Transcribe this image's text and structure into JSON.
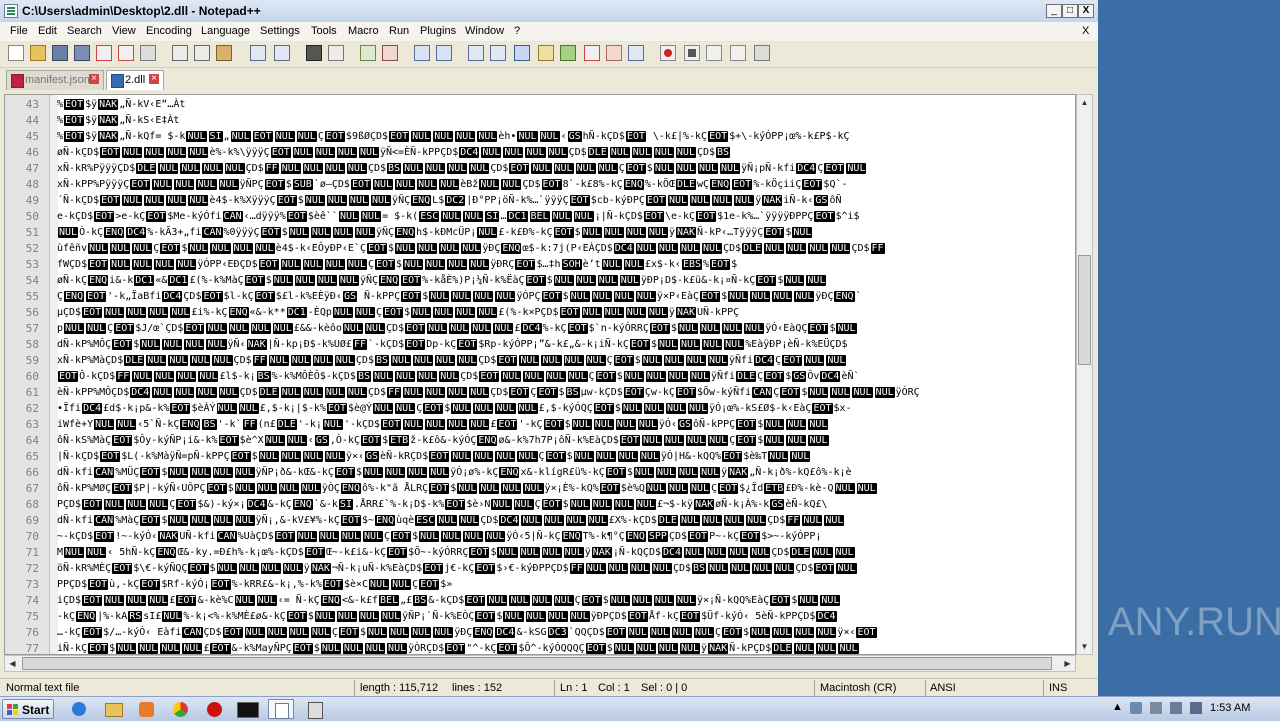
{
  "window": {
    "title": "C:\\Users\\admin\\Desktop\\2.dll - Notepad++",
    "controls": {
      "minimize": "_",
      "maximize": "□",
      "close": "X"
    }
  },
  "menu": {
    "items": [
      "File",
      "Edit",
      "Search",
      "View",
      "Encoding",
      "Language",
      "Settings",
      "Tools",
      "Macro",
      "Run",
      "Plugins",
      "Window",
      "?"
    ],
    "close_glyph": "X"
  },
  "tabs": [
    {
      "label": "manifest.json",
      "active": false
    },
    {
      "label": "2.dll",
      "active": true
    }
  ],
  "editor": {
    "lines": [
      {
        "n": "43",
        "t": "%<b>EOT</b>$ÿ<b>NAK</b>„Ñ-kV‹E“…Àt"
      },
      {
        "n": "44",
        "t": "%<b>EOT</b>$ÿ<b>NAK</b>„Ñ-kS‹E‡Àt"
      },
      {
        "n": "45",
        "t": "%<b>EOT</b>$ÿ<b>NAK</b>„Ñ-kQf= $-k<b>NUL</b><b>SI</b>„<b>NUL</b><b>EOT</b><b>NUL</b><b>NUL</b>Ç<b>EOT</b>$9ßØÇD$<b>EOT</b><b>NUL</b><b>NUL</b><b>NUL</b><b>NUL</b>èh•<b>NUL</b><b>NUL</b>‹<b>GS</b>hÑ-kÇD$<b>EOT</b> \\-k£|%-kÇ<b>EOT</b>$+\\-kýÓPP¡œ%-k£P$-kÇ"
      },
      {
        "n": "46",
        "t": "øÑ-kÇD$<b>EOT</b><b>NUL</b><b>NUL</b><b>NUL</b><b>NUL</b>è%-k%\\ÿÿÿÇ<b>EOT</b><b>NUL</b><b>NUL</b><b>NUL</b><b>NUL</b>ÿÑ<=ÈÑ-kPPÇD$<b>DC4</b><b>NUL</b><b>NUL</b><b>NUL</b><b>NUL</b>ÇD$<b>DLE</b><b>NUL</b><b>NUL</b><b>NUL</b><b>NUL</b>ÇD$<b>BS</b>"
      },
      {
        "n": "47",
        "t": "xÑ-kR%PÿÿÿÇD$<b>DLE</b><b>NUL</b><b>NUL</b><b>NUL</b><b>NUL</b>ÇD$<b>FF</b><b>NUL</b><b>NUL</b><b>NUL</b><b>NUL</b>ÇD$<b>BS</b><b>NUL</b><b>NUL</b><b>NUL</b><b>NUL</b>ÇD$<b>EOT</b><b>NUL</b><b>NUL</b><b>NUL</b><b>NUL</b>Ç<b>EOT</b>$<b>NUL</b><b>NUL</b><b>NUL</b><b>NUL</b>ÿÑ¡pÑ-kfi<b>DC4</b>Ç<b>EOT</b><b>NUL</b>"
      },
      {
        "n": "48",
        "t": "xÑ-kPP%PÿÿÿÇ<b>EOT</b><b>NUL</b><b>NUL</b><b>NUL</b><b>NUL</b>ÿÑPÇ<b>EOT</b>$<b>SUB</b>`ø—ÇD$<b>EOT</b><b>NUL</b><b>NUL</b><b>NUL</b><b>NUL</b>èBž<b>NUL</b><b>NUL</b>ÇD$<b>EOT</b>8`-k£8%-kÇ<b>ENQ</b>%-kÖŒ<b>DLE</b>wÇ<b>ENQ</b><b>EOT</b>%-kÖçiiÇ<b>EOT</b>$Q`-"
      },
      {
        "n": "49",
        "t": "´Ñ-kÇD$<b>EOT</b><b>NUL</b><b>NUL</b><b>NUL</b><b>NUL</b>è4$-k%XÿÿÿÇ<b>EOT</b>$<b>NUL</b><b>NUL</b><b>NUL</b><b>NUL</b>ÿÑÇ<b>ENQ</b>L$<b>DC2</b>|Ð°PP¡öÑ-k%…`ÿÿÿÇ<b>EOT</b>$cb-kýÐPÇ<b>EOT</b><b>NUL</b><b>NUL</b><b>NUL</b><b>NUL</b>ÿ<b>NAK</b>iÑ-k‹<b>GS</b>ôÑ"
      },
      {
        "n": "50",
        "t": "e-kÇD$<b>EOT</b>>e-kÇ<b>EOT</b>$Me-kýÓfi<b>CAN</b>‹…dÿÿÿ%<b>EOT</b>$èê``<b>NUL</b><b>NUL</b>= $-k(<b>ESC</b><b>NUL</b><b>NUL</b><b>SI</b>…<b>DC1</b><b>BEL</b><b>NUL</b><b>NUL</b>¡|Ñ-kÇD$<b>EOT</b>\\e-kÇ<b>EOT</b>$1e-k%…`ÿÿÿÿÐPPÇ<b>EOT</b>$^i$"
      },
      {
        "n": "51",
        "t": "<b>NUL</b>Ò-kÇ<b>ENQ</b><b>DC4</b>%-kÃ3+„fi<b>CAN</b>%0ÿÿÿÇ<b>EOT</b>$<b>NUL</b><b>NUL</b><b>NUL</b><b>NUL</b>ÿÑÇ<b>ENQ</b>h$-kÐMcÜP¡<b>NUL</b>£-k£Ð%-kÇ<b>EOT</b>$<b>NUL</b><b>NUL</b><b>NUL</b><b>NUL</b>ÿ<b>NAK</b>Ñ-kP‹…TÿÿÿÇ<b>EOT</b>$<b>NUL</b>"
      },
      {
        "n": "52",
        "t": "ùfêñv<b>NUL</b><b>NUL</b><b>NUL</b>Ç<b>EOT</b>$<b>NUL</b><b>NUL</b><b>NUL</b><b>NUL</b>è4$-k‹EÔyÐP‹E`Ç<b>EOT</b>$<b>NUL</b><b>NUL</b><b>NUL</b><b>NUL</b>ÿÐÇ<b>ENQ</b>œ$-k:7j(P‹EÀÇD$<b>DC4</b><b>NUL</b><b>NUL</b><b>NUL</b><b>NUL</b>ÇD$<b>DLE</b><b>NUL</b><b>NUL</b><b>NUL</b><b>NUL</b>ÇD$<b>FF</b>"
      },
      {
        "n": "53",
        "t": "fWÇD$<b>EOT</b><b>NUL</b><b>NUL</b><b>NUL</b><b>NUL</b>ÿÓPP‹EÐÇD$<b>EOT</b><b>NUL</b><b>NUL</b><b>NUL</b><b>NUL</b>Ç<b>EOT</b>$<b>NUL</b><b>NUL</b><b>NUL</b><b>NUL</b>ÿÐRÇ<b>EOT</b>$…‡h<b>SOH</b>è’t<b>NUL</b><b>NUL</b>£x$-k‹<b>EBS</b>%<b>EOT</b>$"
      },
      {
        "n": "54",
        "t": "øÑ-kÇ<b>ENQ</b>i&-k<b>DC1</b>«&<b>DC1</b>£(%-k%MàÇ<b>EOT</b>$<b>NUL</b><b>NUL</b><b>NUL</b><b>NUL</b>ÿÑÇ<b>ENQ</b><b>EOT</b>%-kåÈ%)P¡¼Ñ-k%ËàÇ<b>EOT</b>$<b>NUL</b><b>NUL</b><b>NUL</b><b>NUL</b>ÿÐP¡D$-k£ü&-k¡¤Ñ-kÇ<b>EOT</b>$<b>NUL</b><b>NUL</b>"
      },
      {
        "n": "55",
        "t": "Ç<b>ENQ</b><b>EOT</b>'-k„ÏaBfi<b>DC4</b>ÇD$<b>EOT</b>$l-kÇ<b>EOT</b>$£l-k%EÈÿÐ‹<b>GS</b> Ñ-kPPÇ<b>EOT</b>$<b>NUL</b><b>NUL</b><b>NUL</b><b>NUL</b>ÿÓPÇ<b>EOT</b>$<b>NUL</b><b>NUL</b><b>NUL</b><b>NUL</b>ÿ×P‹EàÇ<b>EOT</b>$<b>NUL</b><b>NUL</b><b>NUL</b><b>NUL</b>ÿÐÇ<b>ENQ</b>`"
      },
      {
        "n": "56",
        "t": "µÇD$<b>EOT</b><b>NUL</b><b>NUL</b><b>NUL</b><b>NUL</b>£i%-kÇ<b>ENQ</b>«&-k**<b>DC1</b>-ÈQp<b>NUL</b><b>NUL</b>Ç<b>EOT</b>$<b>NUL</b><b>NUL</b><b>NUL</b><b>NUL</b>£(%-k×PÇD$<b>EOT</b><b>NUL</b><b>NUL</b><b>NUL</b><b>NUL</b>ÿ<b>NAK</b>UÑ-kPPÇ"
      },
      {
        "n": "57",
        "t": "p<b>NUL</b><b>NUL</b>Ç<b>EOT</b>$J/œ`ÇD$<b>EOT</b><b>NUL</b><b>NUL</b><b>NUL</b><b>NUL</b>£&&-kèôo<b>NUL</b><b>NUL</b>ÇD$<b>EOT</b><b>NUL</b><b>NUL</b><b>NUL</b><b>NUL</b>£<b>DC4</b>%-kÇ<b>EOT</b>$`n-kýÓRRÇ<b>EOT</b>$<b>NUL</b><b>NUL</b><b>NUL</b><b>NUL</b>ÿÓ‹EàQÇ<b>EOT</b>$<b>NUL</b>"
      },
      {
        "n": "58",
        "t": "dÑ-kP%MÔÇ<b>EOT</b>$<b>NUL</b><b>NUL</b><b>NUL</b><b>NUL</b>ÿÑ‹<b>NAK</b>|Ñ-kp¡Ð$-k%UØ£<b>FF</b>`-kÇD$<b>EOT</b>Dp-kÇ<b>EOT</b>$Rp-kýÓPP¡”&-k£„&-k¡iÑ-kÇ<b>EOT</b>$<b>NUL</b><b>NUL</b><b>NUL</b><b>NUL</b>%EàÿÐP¡èÑ-k%EÜÇD$"
      },
      {
        "n": "59",
        "t": "xÑ-kP%MàÇD$<b>DLE</b><b>NUL</b><b>NUL</b><b>NUL</b><b>NUL</b>ÇD$<b>FF</b><b>NUL</b><b>NUL</b><b>NUL</b><b>NUL</b>ÇD$<b>BS</b><b>NUL</b><b>NUL</b><b>NUL</b><b>NUL</b>ÇD$<b>EOT</b><b>NUL</b><b>NUL</b><b>NUL</b><b>NUL</b>Ç<b>EOT</b>$<b>NUL</b><b>NUL</b><b>NUL</b><b>NUL</b>ÿÑfi<b>DC4</b>Ç<b>EOT</b><b>NUL</b><b>NUL</b>"
      },
      {
        "n": "60",
        "t": "<b>EOT</b>Ô-kÇD$<b>FF</b><b>NUL</b><b>NUL</b><b>NUL</b><b>NUL</b>£l$-k¡<b>BS</b>%-k%MÔÈÔ$-kÇD$<b>BS</b><b>NUL</b><b>NUL</b><b>NUL</b><b>NUL</b>ÇD$<b>EOT</b><b>NUL</b><b>NUL</b><b>NUL</b><b>NUL</b>Ç<b>EOT</b>$<b>NUL</b><b>NUL</b><b>NUL</b><b>NUL</b>ÿÑfi<b>DLE</b>Ç<b>EOT</b>$<b>GS</b>Ôv<b>DC4</b>èÑ`"
      },
      {
        "n": "61",
        "t": "èÑ-kPP%MÔÇD$<b>DC4</b><b>NUL</b><b>NUL</b><b>NUL</b><b>NUL</b>ÇD$<b>DLE</b><b>NUL</b><b>NUL</b><b>NUL</b><b>NUL</b>ÇD$<b>FF</b><b>NUL</b><b>NUL</b><b>NUL</b><b>NUL</b>ÇD$<b>EOT</b>Ç<b>EOT</b>$<b>BS</b>µw-kÇD$<b>EOT</b>Çw-kÇ<b>EOT</b>$Õw-kýÑfi<b>CAN</b>Ç<b>EOT</b>$<b>NUL</b><b>NUL</b><b>NUL</b><b>NUL</b>ÿÓRÇ"
      },
      {
        "n": "62",
        "t": "•Ïfi<b>DC4</b>£d$-k¡p&-k%<b>EOT</b>$èÀÝ<b>NUL</b><b>NUL</b>£,$-k¡|$-k%<b>EOT</b>$è@Ý<b>NUL</b><b>NUL</b>Ç<b>EOT</b>$<b>NUL</b><b>NUL</b><b>NUL</b><b>NUL</b>£,$-kýÓQÇ<b>EOT</b>$<b>NUL</b><b>NUL</b><b>NUL</b><b>NUL</b>ÿÓ¡œ%-kS£Ø$-k‹EàÇ<b>EOT</b>$x-"
      },
      {
        "n": "63",
        "t": "iWfè+Y<b>NUL</b><b>NUL</b>‹5`Ñ-kÇ<b>ENQ</b><b>BS</b>'-k`<b>FF</b>(n£<b>DLE</b>'-k¡<b>NUL</b>'-kÇD$<b>EOT</b><b>NUL</b><b>NUL</b><b>NUL</b><b>NUL</b>£<b>EOT</b>'-kÇ<b>EOT</b>$<b>NUL</b><b>NUL</b><b>NUL</b><b>NUL</b>ÿÓ‹<b>GS</b>ôÑ-kPPÇ<b>EOT</b>$<b>NUL</b><b>NUL</b><b>NUL</b>"
      },
      {
        "n": "64",
        "t": "ôÑ-kS%MàÇ<b>EOT</b>$Ôy-kýÑP¡i&-k%<b>EOT</b>$è^X<b>NUL</b><b>NUL</b>‹<b>GS</b>,Ò-kÇ<b>EOT</b>$<b>ETB</b>ž-k£ô&-kýÓÇ<b>ENQ</b>ø&-k%7h7P¡ôÑ-k%EàÇD$<b>EOT</b><b>NUL</b><b>NUL</b><b>NUL</b><b>NUL</b>Ç<b>EOT</b>$<b>NUL</b><b>NUL</b><b>NUL</b>"
      },
      {
        "n": "65",
        "t": "|Ñ-kÇD$<b>EOT</b>$L(-k%MàÿÑ=pÑ-kPPÇ<b>EOT</b>$<b>NUL</b><b>NUL</b><b>NUL</b><b>NUL</b>ÿ×‹<b>GS</b>èÑ-kRÇD$<b>EOT</b><b>NUL</b><b>NUL</b><b>NUL</b><b>NUL</b>Ç<b>EOT</b>$<b>NUL</b><b>NUL</b><b>NUL</b><b>NUL</b>ÿÓ|H&-kQQ%<b>EOT</b>$è‰T<b>NUL</b><b>NUL</b>"
      },
      {
        "n": "66",
        "t": "dÑ-kfi<b>CAN</b>%MÜÇ<b>EOT</b>$<b>NUL</b><b>NUL</b><b>NUL</b><b>NUL</b>ÿÑP¡ð&-kŒ&-kÇ<b>EOT</b>$<b>NUL</b><b>NUL</b><b>NUL</b><b>NUL</b>ÿÓ¡ø%-kÇ<b>ENQ</b>x&-klígR£ü%-kÇ<b>EOT</b>$<b>NUL</b><b>NUL</b><b>NUL</b><b>NUL</b>ÿ<b>NAK</b>„Ñ-k¡ð%-kQ£ô%-k¡è"
      },
      {
        "n": "67",
        "t": "ôÑ-kP%MØÇ<b>EOT</b>$P|-kýÑ‹UÔPÇ<b>EOT</b>$<b>NUL</b><b>NUL</b><b>NUL</b><b>NUL</b>ÿÒÇ<b>ENQ</b>ô%-k\"ã ÅLRÇ<b>EOT</b>$<b>NUL</b><b>NUL</b><b>NUL</b><b>NUL</b>ÿ×¡È%-kQ%<b>EOT</b>$è%Q<b>NUL</b><b>NUL</b><b>NUL</b>Ç<b>EOT</b>$¿Ïd<b>ETB</b>£Ð%-kè-Q<b>NUL</b><b>NUL</b>"
      },
      {
        "n": "68",
        "t": "PÇD$<b>EOT</b><b>NUL</b><b>NUL</b><b>NUL</b>Ç<b>EOT</b>$&)-ký×¡<b>DC4</b>&-kÇ<b>ENQ</b>`&-k<b>SI</b>.ÅRR£`%-k¡D$-k%<b>EOT</b>$è›N<b>NUL</b><b>NUL</b>Ç<b>EOT</b>$<b>NUL</b><b>NUL</b><b>NUL</b><b>NUL</b>£¬$-kÿ<b>NAK</b>øÑ-k¡À%-k<b>GS</b>èÑ-kQ£\\"
      },
      {
        "n": "69",
        "t": "dÑ-kfi<b>CAN</b>%MàÇ<b>EOT</b>$<b>NUL</b><b>NUL</b><b>NUL</b><b>NUL</b>ÿÑ¡,&-kV£¥%-kÇ<b>EOT</b>$~<b>ENQ</b>ùqè<b>ESC</b><b>NUL</b><b>NUL</b>ÇD$<b>DC4</b><b>NUL</b><b>NUL</b><b>NUL</b><b>NUL</b>£X%-kÇD$<b>DLE</b><b>NUL</b><b>NUL</b><b>NUL</b><b>NUL</b>ÇD$<b>FF</b><b>NUL</b><b>NUL</b>"
      },
      {
        "n": "70",
        "t": "~-kÇD$<b>EOT</b>!~-kýÓ‹<b>NAK</b>UÑ-kfi<b>CAN</b>%UàÇD$<b>EOT</b><b>NUL</b><b>NUL</b><b>NUL</b><b>NUL</b>Ç<b>EOT</b>$<b>NUL</b><b>NUL</b><b>NUL</b><b>NUL</b>ÿÓ‹5|Ñ-kÇ<b>ENQ</b>T%-k¶°Ç<b>ENQ</b><b>SPP</b>ÇD$<b>EOT</b>P~-kÇ<b>EOT</b>$>~-kýÓPP¡"
      },
      {
        "n": "71",
        "t": "M<b>NUL</b><b>NUL</b>‹ 5hÑ-kÇ<b>ENQ</b>Œ&-ky.=Ð£h%-k¡œ%-kÇD$<b>EOT</b>Œ~-k£i&-kÇ<b>EOT</b>$Ö~-kýÓRRÇ<b>EOT</b>$<b>NUL</b><b>NUL</b><b>NUL</b><b>NUL</b>ÿ<b>NAK</b>¡Ñ-kQÇD$<b>DC4</b><b>NUL</b><b>NUL</b><b>NUL</b><b>NUL</b>ÇD$<b>DLE</b><b>NUL</b><b>NUL</b>"
      },
      {
        "n": "72",
        "t": "öÑ-kR%MÈÇ<b>EOT</b>$\\€-kýÑQÇ<b>EOT</b>$<b>NUL</b><b>NUL</b><b>NUL</b><b>NUL</b>ÿ<b>NAK</b>¬Ñ-k¡uÑ-k%EàÇD$<b>EOT</b>j€-kÇ<b>EOT</b>$›€-kýÐPPÇD$<b>FF</b><b>NUL</b><b>NUL</b><b>NUL</b><b>NUL</b>ÇD$<b>BS</b><b>NUL</b><b>NUL</b><b>NUL</b><b>NUL</b>ÇD$<b>EOT</b><b>NUL</b>"
      },
      {
        "n": "73",
        "t": "PPÇD$<b>EOT</b>ù,-kÇ<b>EOT</b>$Rf-kýÓ¡<b>EOT</b>%-kRR£&-k¡,%-k%<b>EOT</b>$è×C<b>NUL</b><b>NUL</b>Ç<b>EOT</b>$»"
      },
      {
        "n": "74",
        "t": "iÇD$<b>EOT</b><b>NUL</b><b>NUL</b><b>NUL</b>£<b>EOT</b>&-kè%C<b>NUL</b><b>NUL</b>‹= Ñ-kÇ<b>ENQ</b><&-k£f<b>BEL</b>„£<b>BS</b>&-kÇD$<b>EOT</b><b>NUL</b><b>NUL</b><b>NUL</b><b>NUL</b>Ç<b>EOT</b>$<b>NUL</b><b>NUL</b><b>NUL</b><b>NUL</b>ÿ×¡Ñ-kQQ%EàÇ<b>EOT</b>$<b>NUL</b><b>NUL</b>"
      },
      {
        "n": "75",
        "t": "-kÇ<b>ENQ</b>|%-kA<b>RS</b>sI£<b>NUL</b>%-k¡<%-k%MÈ£ø&-kÇ<b>EOT</b>$<b>NUL</b><b>NUL</b><b>NUL</b><b>NUL</b>ÿÑP¡`Ñ-k%EÒÇ<b>EOT</b>$<b>NUL</b><b>NUL</b><b>NUL</b><b>NUL</b>ÿÐPÇD$<b>EOT</b>Åf-kÇ<b>EOT</b>$Üf-kýÓ‹ 5èÑ-kPPÇD$<b>DC4</b>"
      },
      {
        "n": "76",
        "t": "…-kÇ<b>EOT</b>$/…-kýÓ‹ Eàfi<b>CAN</b>ÇD$<b>EOT</b><b>NUL</b><b>NUL</b><b>NUL</b><b>NUL</b>Ç<b>EOT</b>$<b>NUL</b><b>NUL</b><b>NUL</b><b>NUL</b>ÿÐÇ<b>ENQ</b><b>DC4</b>&-kSG<b>DC3</b>`QQÇD$<b>EOT</b><b>NUL</b><b>NUL</b><b>NUL</b><b>NUL</b>Ç<b>EOT</b>$<b>NUL</b><b>NUL</b><b>NUL</b><b>NUL</b>ÿ×‹<b>EOT</b>"
      },
      {
        "n": "77",
        "t": "iÑ-kÇ<b>EOT</b>$<b>NUL</b><b>NUL</b><b>NUL</b><b>NUL</b>£<b>EOT</b>&-k%MayÑPÇ<b>EOT</b>$<b>NUL</b><b>NUL</b><b>NUL</b><b>NUL</b>ÿÒRÇD$<b>EOT</b>\"^-kÇ<b>EOT</b>$Ô^-kýÓQQQÇ<b>EOT</b>$<b>NUL</b><b>NUL</b><b>NUL</b><b>NUL</b>ÿ<b>NAK</b>Ñ-kPÇD$<b>DLE</b><b>NUL</b><b>NUL</b><b>NUL</b>"
      }
    ]
  },
  "status": {
    "file_type": "Normal text file",
    "length": "length : 115,712",
    "lines": "lines : 152",
    "ln": "Ln : 1",
    "col": "Col : 1",
    "sel": "Sel : 0 | 0",
    "eol": "Macintosh (CR)",
    "encoding": "ANSI",
    "mode": "INS"
  },
  "taskbar": {
    "start_label": "Start",
    "clock": "1:53 AM"
  },
  "watermark": "ANY.RUN",
  "colors": {
    "title_bar": "#c4d5ec",
    "desktop": "#3a6ea5",
    "control_char_bg": "#000000",
    "line_number": "#808080"
  }
}
